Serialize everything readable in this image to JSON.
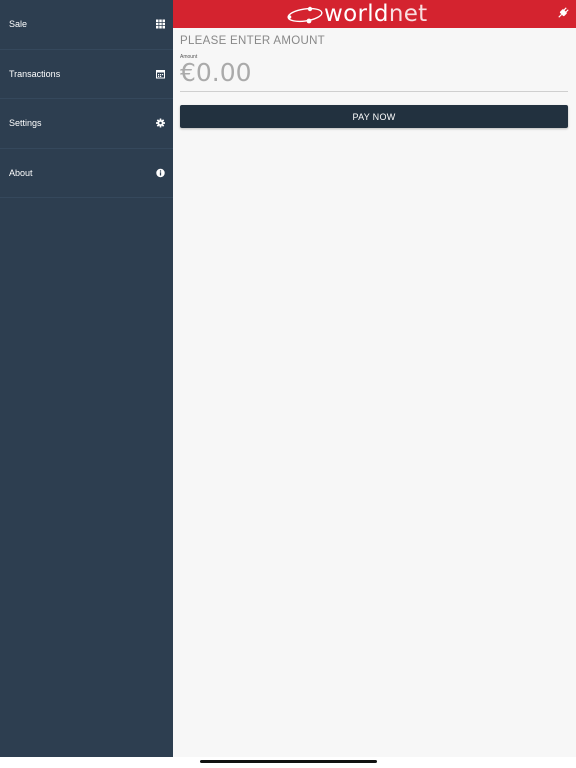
{
  "brand": {
    "name_part1": "world",
    "name_part2": "net",
    "accent": "#d4232f",
    "sidebar_bg": "#2d3e50",
    "button_bg": "#22313f"
  },
  "sidebar": {
    "items": [
      {
        "label": "Sale",
        "icon": "grid-icon"
      },
      {
        "label": "Transactions",
        "icon": "calendar-icon"
      },
      {
        "label": "Settings",
        "icon": "gear-icon"
      },
      {
        "label": "About",
        "icon": "info-icon"
      }
    ]
  },
  "header": {
    "status_icon": "plug-icon"
  },
  "main": {
    "prompt": "PLEASE ENTER AMOUNT",
    "amount_label": "Amount",
    "amount_value": "€0.00",
    "pay_button": "PAY NOW"
  }
}
